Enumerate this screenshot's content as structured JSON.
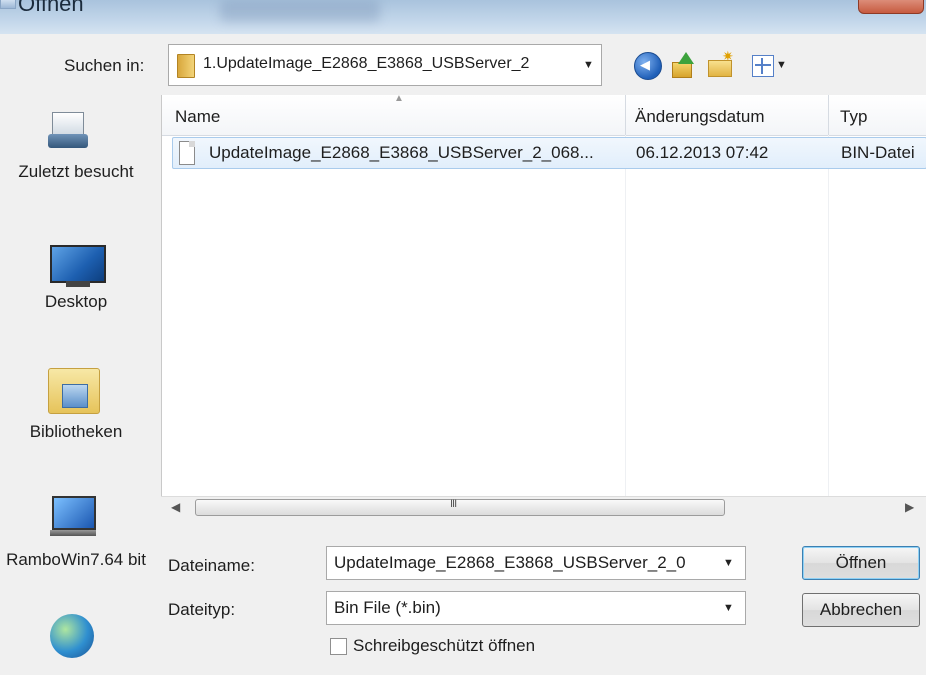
{
  "window": {
    "title": "Öffnen"
  },
  "lookin": {
    "label": "Suchen in:",
    "value": "1.UpdateImage_E2868_E3868_USBServer_2"
  },
  "toolbar": {
    "back_icon": "back-arrow-icon",
    "up_icon": "up-folder-icon",
    "new_folder_icon": "new-folder-icon",
    "views_icon": "views-menu-icon"
  },
  "places": [
    {
      "label": "Zuletzt besucht",
      "icon": "recent-places-icon"
    },
    {
      "label": "Desktop",
      "icon": "desktop-icon"
    },
    {
      "label": "Bibliotheken",
      "icon": "libraries-icon"
    },
    {
      "label": "RamboWin7.64 bit",
      "icon": "computer-icon"
    },
    {
      "label": "",
      "icon": "network-icon"
    }
  ],
  "columns": {
    "name": "Name",
    "date": "Änderungsdatum",
    "type": "Typ"
  },
  "files": [
    {
      "name": "UpdateImage_E2868_E3868_USBServer_2_068...",
      "date": "06.12.2013 07:42",
      "type": "BIN-Datei"
    }
  ],
  "scrollbar": {
    "grip": "III"
  },
  "filename": {
    "label": "Dateiname:",
    "value": "UpdateImage_E2868_E3868_USBServer_2_0"
  },
  "filetype": {
    "label": "Dateityp:",
    "value": "Bin File (*.bin)"
  },
  "readonly": {
    "label": "Schreibgeschützt öffnen",
    "checked": false
  },
  "buttons": {
    "open": "Öffnen",
    "cancel": "Abbrechen"
  },
  "colors": {
    "selection": "#e1eefb",
    "selection_border": "#a9cbec",
    "window_bg": "#f0f0f0"
  }
}
